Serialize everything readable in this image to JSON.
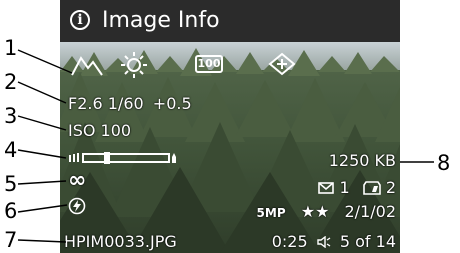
{
  "header": {
    "title": "Image Info",
    "info_icon": "info-circle-icon"
  },
  "top_icons": [
    "landscape-mode-icon",
    "sunlight-white-balance-icon",
    "iso-100-icon",
    "ae-metering-icon"
  ],
  "top_icon_badge": "100",
  "exposure": {
    "aperture": "F2.6",
    "shutter": "1/60",
    "ev": "+0.5"
  },
  "iso": "ISO 100",
  "flash_range_icon": "focus-range-slider-icon",
  "focus_infinity": "∞",
  "flash_icon": "flash-off-icon",
  "file_size": "1250 KB",
  "email_count": "1",
  "print_count": "2",
  "resolution": "5MP",
  "quality_stars": "★★",
  "date": "2/1/02",
  "filename": "HPIM0033.JPG",
  "audio_duration": "0:25",
  "image_position": "5 of 14",
  "callouts": [
    "1",
    "2",
    "3",
    "4",
    "5",
    "6",
    "7",
    "8"
  ]
}
